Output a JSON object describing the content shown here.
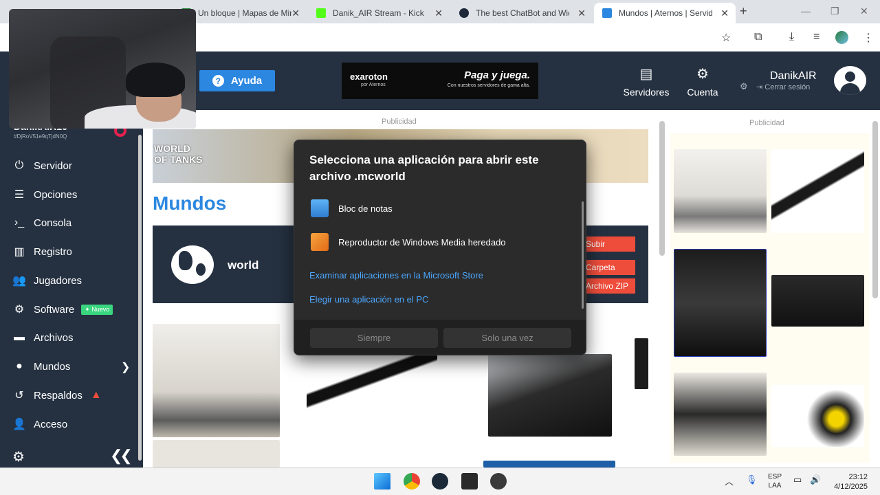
{
  "browser": {
    "tabs": [
      {
        "title": "Un bloque | Mapas de Mine",
        "color": "#2e8b3e"
      },
      {
        "title": "Danik_AIR Stream - Kick",
        "color": "#53fc18"
      },
      {
        "title": "The best ChatBot and Widg",
        "color": "#1e2a3a"
      },
      {
        "title": "Mundos | Aternos | Servido",
        "color": "#2b87e0"
      }
    ],
    "new_tab": "+",
    "close_glyph": "✕"
  },
  "header": {
    "help_label": "Ayuda",
    "banner": {
      "brand": "exaroton",
      "brand_sub": "por Aternos",
      "slogan": "Paga y juega.",
      "slogan_sub": "Con nuestros servidores de gama alta."
    },
    "nav": [
      {
        "label": "Servidores",
        "icon": "servers-icon"
      },
      {
        "label": "Cuenta",
        "icon": "account-icon"
      }
    ],
    "username": "DanikAIR",
    "logout": "Cerrar sesión"
  },
  "sidebar": {
    "server_name": "DanikAIR16",
    "server_id": "#DjRoV51e9qTjdN0Q",
    "items": [
      {
        "label": "Servidor",
        "icon": "power-icon"
      },
      {
        "label": "Opciones",
        "icon": "options-icon"
      },
      {
        "label": "Consola",
        "icon": "console-icon"
      },
      {
        "label": "Registro",
        "icon": "log-icon"
      },
      {
        "label": "Jugadores",
        "icon": "players-icon"
      },
      {
        "label": "Software",
        "icon": "software-icon",
        "badge": "Nuevo"
      },
      {
        "label": "Archivos",
        "icon": "files-icon"
      },
      {
        "label": "Mundos",
        "icon": "globe-icon"
      },
      {
        "label": "Respaldos",
        "icon": "backup-icon"
      },
      {
        "label": "Acceso",
        "icon": "access-icon"
      }
    ]
  },
  "main": {
    "ad_label": "Publicidad",
    "ad_logo": "WORLD OF TANKS",
    "page_title": "Mundos",
    "world_name": "world",
    "actions": {
      "upload": "Subir",
      "folder": "Carpeta",
      "zip": "Archivo ZIP"
    }
  },
  "dialog": {
    "title": "Selecciona una aplicación para abrir este archivo .mcworld",
    "apps": [
      {
        "label": "Bloc de notas",
        "icon": "notepad-icon"
      },
      {
        "label": "Reproductor de Windows Media heredado",
        "icon": "media-player-icon"
      }
    ],
    "links": [
      "Examinar aplicaciones en la Microsoft Store",
      "Elegir una aplicación en el PC"
    ],
    "buttons": {
      "always": "Siempre",
      "once": "Solo una vez"
    }
  },
  "taskbar": {
    "lang_top": "ESP",
    "lang_bottom": "LAA",
    "time": "23:12",
    "date": "4/12/2025"
  },
  "colors": {
    "accent": "#2b87e0",
    "panel": "#253141",
    "danger": "#e6214e",
    "success": "#3ad57f"
  }
}
